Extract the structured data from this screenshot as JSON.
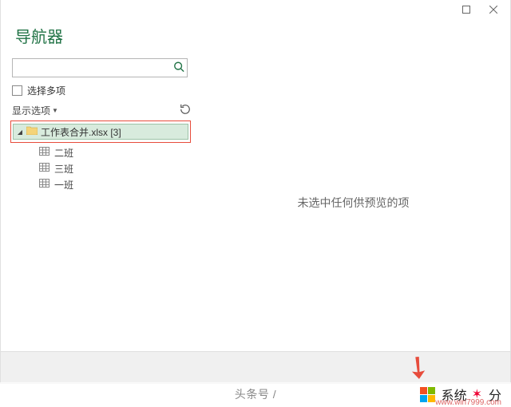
{
  "window": {
    "title": "导航器"
  },
  "search": {
    "value": "",
    "placeholder": ""
  },
  "multiselect": {
    "label": "选择多项"
  },
  "options": {
    "label": "显示选项"
  },
  "tree": {
    "workbook": {
      "name": "工作表合并.xlsx [3]"
    },
    "sheets": [
      {
        "label": "二班"
      },
      {
        "label": "三班"
      },
      {
        "label": "一班"
      }
    ]
  },
  "preview": {
    "empty_message": "未选中任何供预览的项"
  },
  "overlay": {
    "center_text": "头条号 /",
    "brand_text": "系统",
    "brand_tail": "分",
    "url": "www.win7999.com"
  }
}
